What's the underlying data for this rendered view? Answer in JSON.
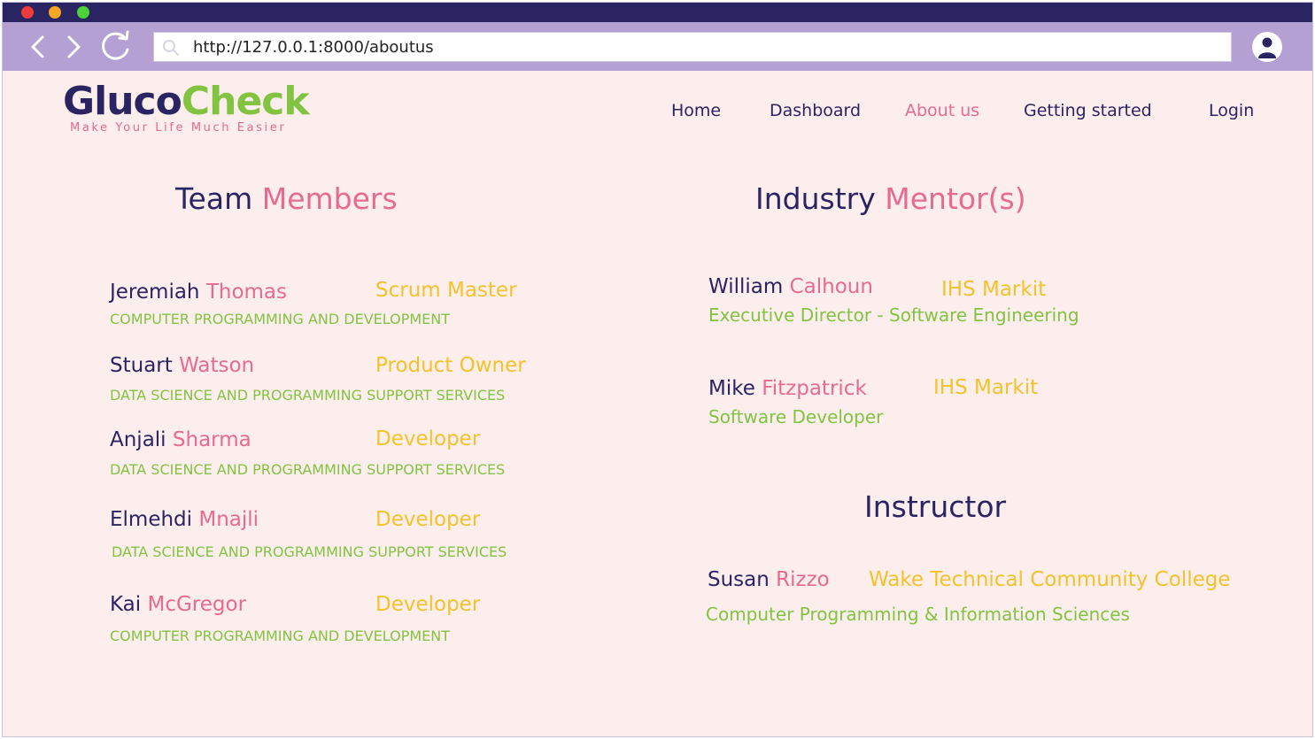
{
  "browser": {
    "url": "http://127.0.0.1:8000/aboutus",
    "colors": {
      "titlebar": "#2a2463",
      "toolbar": "#b5a0d3",
      "close": "#ee3b3b",
      "minimize": "#f5a623",
      "maximize": "#4cd137"
    }
  },
  "logo": {
    "part1": "Gluco",
    "part2": "Check",
    "tagline": "Make Your Life Much Easier"
  },
  "nav": {
    "home": "Home",
    "dashboard": "Dashboard",
    "about": "About us",
    "getting_started": "Getting started",
    "login": "Login"
  },
  "team": {
    "title_a": "Team",
    "title_b": "Members",
    "members": [
      {
        "first": "Jeremiah",
        "last": "Thomas",
        "role": "Scrum Master",
        "dept": "COMPUTER PROGRAMMING AND DEVELOPMENT"
      },
      {
        "first": "Stuart",
        "last": "Watson",
        "role": "Product Owner",
        "dept": "DATA SCIENCE AND PROGRAMMING SUPPORT SERVICES"
      },
      {
        "first": "Anjali",
        "last": "Sharma",
        "role": "Developer",
        "dept": "DATA SCIENCE AND PROGRAMMING SUPPORT SERVICES"
      },
      {
        "first": "Elmehdi",
        "last": "Mnajli",
        "role": "Developer",
        "dept": "DATA SCIENCE AND PROGRAMMING SUPPORT SERVICES"
      },
      {
        "first": "Kai",
        "last": "McGregor",
        "role": "Developer",
        "dept": "COMPUTER PROGRAMMING AND DEVELOPMENT"
      }
    ]
  },
  "mentors": {
    "title_a": "Industry",
    "title_b": "Mentor(s)",
    "people": [
      {
        "first": "William",
        "last": "Calhoun",
        "org": "IHS Markit",
        "title": "Executive Director - Software Engineering"
      },
      {
        "first": "Mike",
        "last": "Fitzpatrick",
        "org": "IHS Markit",
        "title": "Software Developer"
      }
    ]
  },
  "instructor": {
    "title": "Instructor",
    "first": "Susan",
    "last": "Rizzo",
    "org": "Wake Technical Community College",
    "dept": "Computer Programming & Information Sciences"
  }
}
